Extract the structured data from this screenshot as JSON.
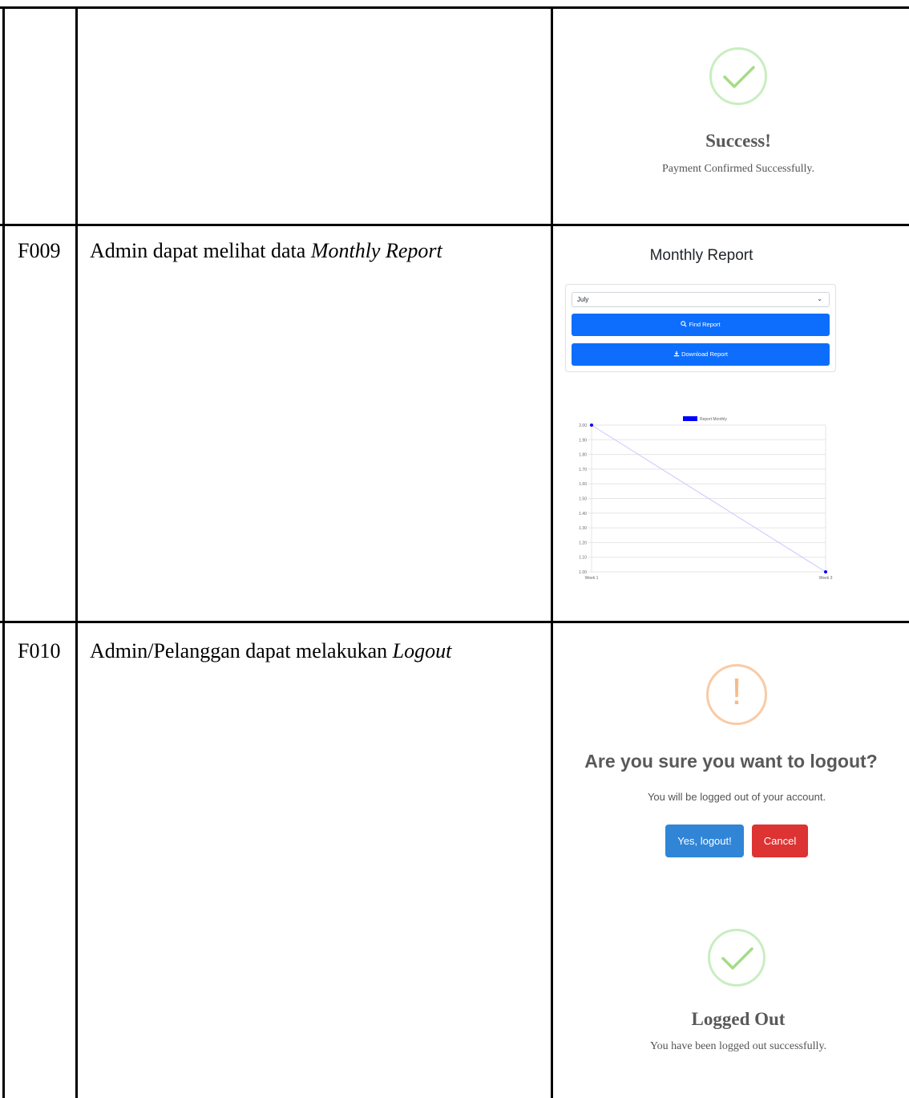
{
  "rows": [
    {
      "id": "",
      "description": ""
    },
    {
      "id": "F009",
      "description_prefix": "Admin dapat melihat data ",
      "description_italic": "Monthly Report"
    },
    {
      "id": "F010",
      "description_prefix": "Admin/Pelanggan dapat melakukan ",
      "description_italic": "Logout"
    }
  ],
  "payment_success": {
    "icon": "check-icon",
    "title": "Success!",
    "text": "Payment Confirmed Successfully."
  },
  "monthly_report": {
    "title": "Monthly Report",
    "month_select_value": "July",
    "find_button_label": "Find Report",
    "find_button_icon": "search-icon",
    "download_button_label": "Download Report",
    "download_button_icon": "download-icon",
    "accent_color": "#0d6efd"
  },
  "chart_data": {
    "type": "line",
    "legend": [
      "Report Monthly"
    ],
    "legend_position": "top",
    "x": [
      "Week 1",
      "Week 3"
    ],
    "series": [
      {
        "name": "Report Monthly",
        "values": [
          2.0,
          1.0
        ],
        "color": "#0000ff"
      }
    ],
    "yticks": [
      "2.00",
      "1.90",
      "1.80",
      "1.70",
      "1.60",
      "1.50",
      "1.40",
      "1.30",
      "1.20",
      "1.10",
      "1.00"
    ],
    "ylim": [
      1.0,
      2.0
    ],
    "grid": true
  },
  "logout_confirm": {
    "icon": "warning-icon",
    "title": "Are you sure you want to logout?",
    "text": "You will be logged out of your account.",
    "confirm_label": "Yes, logout!",
    "cancel_label": "Cancel",
    "confirm_color": "#3085d6",
    "cancel_color": "#dd3333"
  },
  "logout_success": {
    "icon": "check-icon",
    "title": "Logged Out",
    "text": "You have been logged out successfully."
  }
}
